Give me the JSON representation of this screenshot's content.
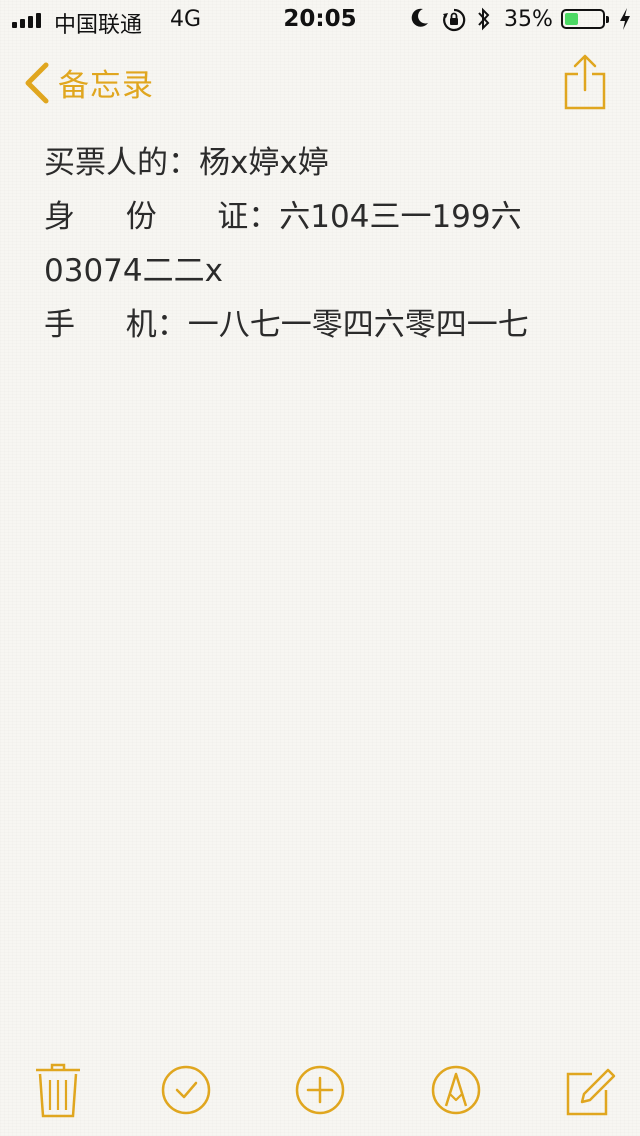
{
  "status_bar": {
    "carrier": "中国联通",
    "network": "4G",
    "time": "20:05",
    "battery_percent": "35%",
    "battery_level": 0.35,
    "icons": [
      "signal-bars-icon",
      "moon-icon",
      "rotation-lock-icon",
      "bluetooth-icon",
      "battery-icon",
      "charging-bolt-icon"
    ]
  },
  "nav": {
    "back_label": "备忘录",
    "share_icon": "share-icon"
  },
  "note": {
    "lines": [
      "买票人的：杨x婷x婷",
      "身　  份　   证：六104三一199六",
      "03074二二x",
      "手　  机：一八七一零四六零四一七"
    ]
  },
  "toolbar": {
    "items": [
      "trash-icon",
      "checklist-icon",
      "add-icon",
      "markup-icon",
      "compose-icon"
    ]
  },
  "colors": {
    "accent": "#e0a61f",
    "battery_fill": "#4cd964",
    "background": "#f7f6f2",
    "text": "#2b2b2b"
  }
}
